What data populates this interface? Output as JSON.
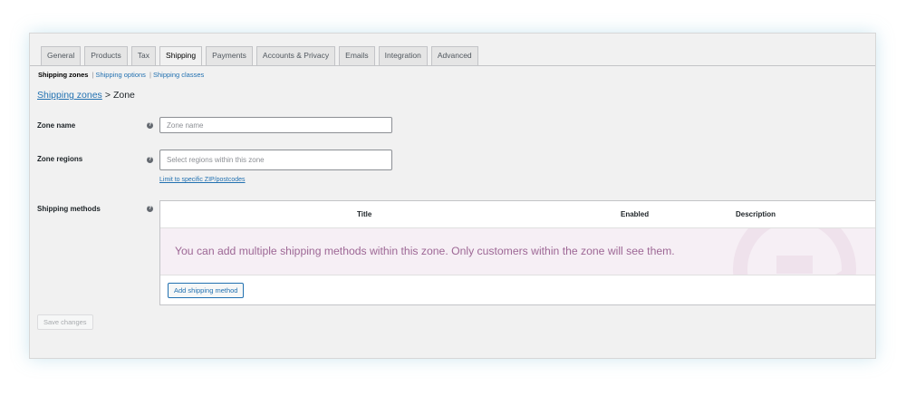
{
  "tabs": [
    {
      "label": "General"
    },
    {
      "label": "Products"
    },
    {
      "label": "Tax"
    },
    {
      "label": "Shipping",
      "active": true
    },
    {
      "label": "Payments"
    },
    {
      "label": "Accounts & Privacy"
    },
    {
      "label": "Emails"
    },
    {
      "label": "Integration"
    },
    {
      "label": "Advanced"
    }
  ],
  "subnav": {
    "current": "Shipping zones",
    "sep1": "|",
    "link1": "Shipping options",
    "sep2": "|",
    "link2": "Shipping classes"
  },
  "breadcrumb": {
    "link": "Shipping zones",
    "separator": ">",
    "current": "Zone"
  },
  "form": {
    "zone_name_label": "Zone name",
    "zone_name_placeholder": "Zone name",
    "zone_regions_label": "Zone regions",
    "zone_regions_placeholder": "Select regions within this zone",
    "limit_link": "Limit to specific ZIP/postcodes",
    "shipping_methods_label": "Shipping methods",
    "help_glyph": "?"
  },
  "methods_table": {
    "col_title": "Title",
    "col_enabled": "Enabled",
    "col_description": "Description",
    "blank_message": "You can add multiple shipping methods within this zone. Only customers within the zone will see them.",
    "add_button": "Add shipping method"
  },
  "save_button": "Save changes",
  "colors": {
    "accent": "#2271b1",
    "blank_bg": "#f6eff5",
    "blank_text": "#9d6795",
    "page_bg": "#f1f1f1"
  }
}
